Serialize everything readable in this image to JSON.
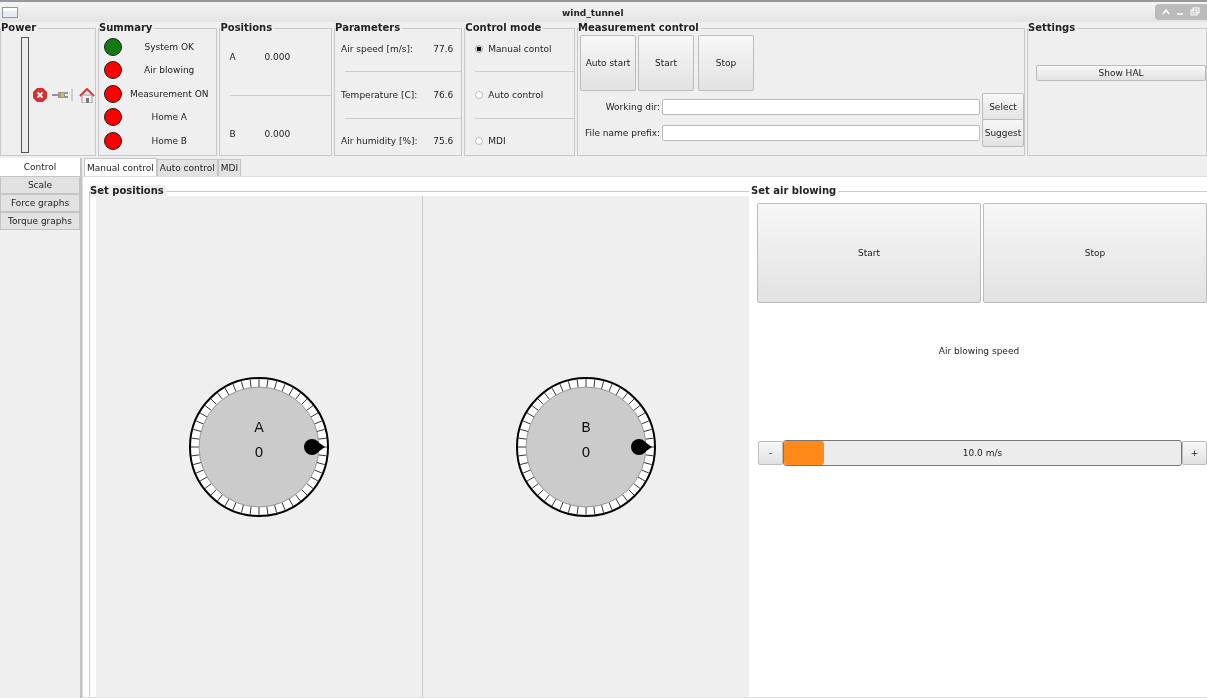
{
  "window": {
    "title": "wind_tunnel"
  },
  "power": {
    "title": "Power"
  },
  "summary": {
    "title": "Summary",
    "items": [
      {
        "label": "System OK",
        "color": "#117a11"
      },
      {
        "label": "Air blowing",
        "color": "#ff0000"
      },
      {
        "label": "Measurement ON",
        "color": "#ff0000"
      },
      {
        "label": "Home A",
        "color": "#ff0000"
      },
      {
        "label": "Home B",
        "color": "#ff0000"
      }
    ]
  },
  "positions": {
    "title": "Positions",
    "items": [
      {
        "axis": "A",
        "value": "0.000"
      },
      {
        "axis": "B",
        "value": "0.000"
      }
    ]
  },
  "parameters": {
    "title": "Parameters",
    "items": [
      {
        "label": "Air speed [m/s]:",
        "value": "77.6"
      },
      {
        "label": "Temperature [C]:",
        "value": "76.6"
      },
      {
        "label": "Air humidity [%]:",
        "value": "75.6"
      }
    ]
  },
  "control_mode": {
    "title": "Control mode",
    "options": [
      {
        "label": "Manual contol",
        "selected": true
      },
      {
        "label": "Auto control",
        "selected": false
      },
      {
        "label": "MDI",
        "selected": false
      }
    ]
  },
  "measurement_control": {
    "title": "Measurement control",
    "buttons": [
      "Auto start",
      "Start",
      "Stop"
    ],
    "fields": [
      {
        "label": "Working dir:",
        "button": "Select"
      },
      {
        "label": "File name prefix:",
        "button": "Suggest"
      }
    ]
  },
  "settings": {
    "title": "Settings",
    "button": "Show HAL"
  },
  "side_tabs": [
    {
      "label": "Control",
      "selected": true
    },
    {
      "label": "Scale",
      "selected": false
    },
    {
      "label": "Force graphs",
      "selected": false
    },
    {
      "label": "Torque graphs",
      "selected": false
    }
  ],
  "tabs": [
    {
      "label": "Manual control",
      "selected": true
    },
    {
      "label": "Auto control",
      "selected": false
    },
    {
      "label": "MDI",
      "selected": false
    }
  ],
  "set_positions": {
    "title": "Set positions",
    "dials": [
      {
        "label": "A",
        "value": "0"
      },
      {
        "label": "B",
        "value": "0"
      }
    ]
  },
  "set_air_blowing": {
    "title": "Set air blowing",
    "buttons": [
      "Start",
      "Stop"
    ],
    "speed_label": "Air blowing speed",
    "slider": {
      "minus": "-",
      "plus": "+",
      "reading": "10.0 m/s",
      "level": 0
    }
  }
}
